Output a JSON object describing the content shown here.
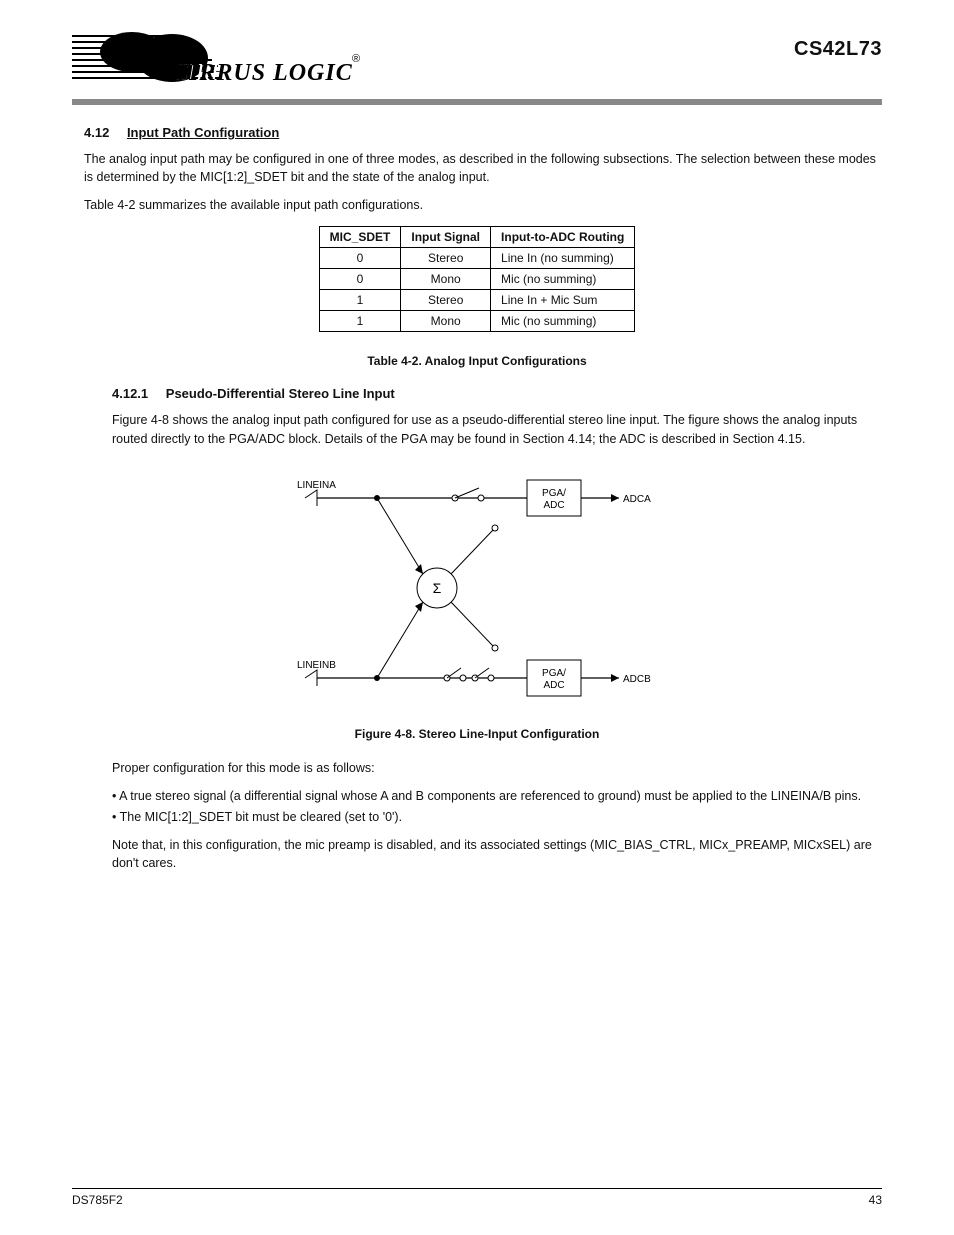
{
  "header": {
    "logo_text": "CIRRUS LOGIC",
    "part_no": "CS42L73"
  },
  "section": {
    "number": "4.12",
    "title": "Input Path Configuration",
    "para1": "The analog input path may be configured in one of three modes, as described in the following subsections. The selection between these modes is determined by the MIC[1:2]_SDET bit and the state of the analog input.",
    "para2": "Table 4-2 summarizes the available input path configurations."
  },
  "table2": {
    "headers": [
      "MIC_SDET",
      "Input Signal",
      "Input-to-ADC Routing"
    ],
    "rows": [
      [
        "0",
        "Stereo",
        "Line In (no summing)"
      ],
      [
        "0",
        "Mono",
        "Mic (no summing)"
      ],
      [
        "1",
        "Stereo",
        "Line In + Mic Sum"
      ],
      [
        "1",
        "Mono",
        "Mic (no summing)"
      ]
    ],
    "caption": "Table 4-2. Analog Input Configurations"
  },
  "subsection1": {
    "number": "4.12.1",
    "title": "Pseudo-Differential Stereo Line Input",
    "text": "Figure 4-8 shows the analog input path configured for use as a pseudo-differential stereo line input. The figure shows the analog inputs routed directly to the PGA/ADC block. Details of the PGA may be found in Section 4.14; the ADC is described in Section 4.15."
  },
  "figure": {
    "left_in": "LINEINA",
    "right_in": "LINEINB",
    "left_adc_top": "PGA/",
    "left_adc_bot": "ADC",
    "left_out": "ADCA",
    "right_adc_top": "PGA/",
    "right_adc_bot": "ADC",
    "right_out": "ADCB",
    "sum": "Σ",
    "caption": "Figure 4-8. Stereo Line-Input Configuration"
  },
  "config_para": "Proper configuration for this mode is as follows:",
  "bullets": [
    "• A true stereo signal (a differential signal whose A and B components are referenced to ground) must be applied to the LINEINA/B pins.",
    "• The MIC[1:2]_SDET bit must be cleared (set to '0')."
  ],
  "trailing": "Note that, in this configuration, the mic preamp is disabled, and its associated settings (MIC_BIAS_CTRL, MICx_PREAMP, MICxSEL) are don't cares.",
  "footer": {
    "left": "DS785F2",
    "right": "43"
  }
}
